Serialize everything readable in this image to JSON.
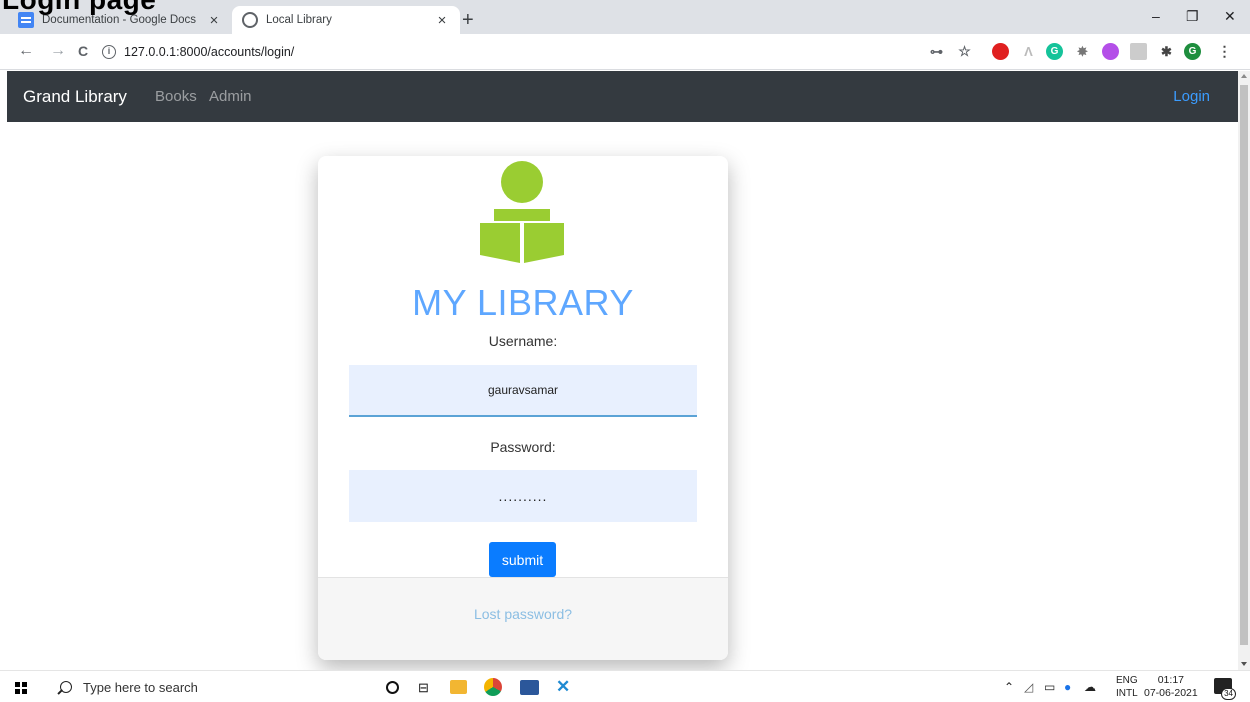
{
  "overlay_heading": "Login page",
  "browser": {
    "tabs": [
      {
        "label": "Documentation - Google Docs",
        "close": "×",
        "icon": "google-docs-icon"
      },
      {
        "label": "Local Library",
        "close": "×",
        "icon": "globe-icon"
      }
    ],
    "new_tab": "+",
    "window_controls": {
      "minimize": "–",
      "restore": "❐",
      "close": "✕"
    },
    "nav": {
      "back": "←",
      "forward": "→",
      "reload": "C"
    },
    "address_info_icon": "ⓘ",
    "address": "127.0.0.1:8000/accounts/login/",
    "toolbar_icons": {
      "key": "⊶",
      "star": "☆",
      "profile_initial": "G"
    }
  },
  "navbar": {
    "brand": "Grand Library",
    "links": [
      "Books",
      "Admin"
    ],
    "login": "Login"
  },
  "login_card": {
    "title": "MY LIBRARY",
    "username_label": "Username:",
    "username_value": "gauravsamar",
    "password_label": "Password:",
    "password_value": "..........",
    "submit": "submit",
    "lost_password": "Lost password?",
    "icon_color": "#9acd32",
    "title_color": "#5ea7ff"
  },
  "taskbar": {
    "search_placeholder": "Type here to search",
    "lang_line1": "ENG",
    "lang_line2": "INTL",
    "time": "01:17",
    "date": "07-06-2021",
    "notification_count": "34"
  }
}
